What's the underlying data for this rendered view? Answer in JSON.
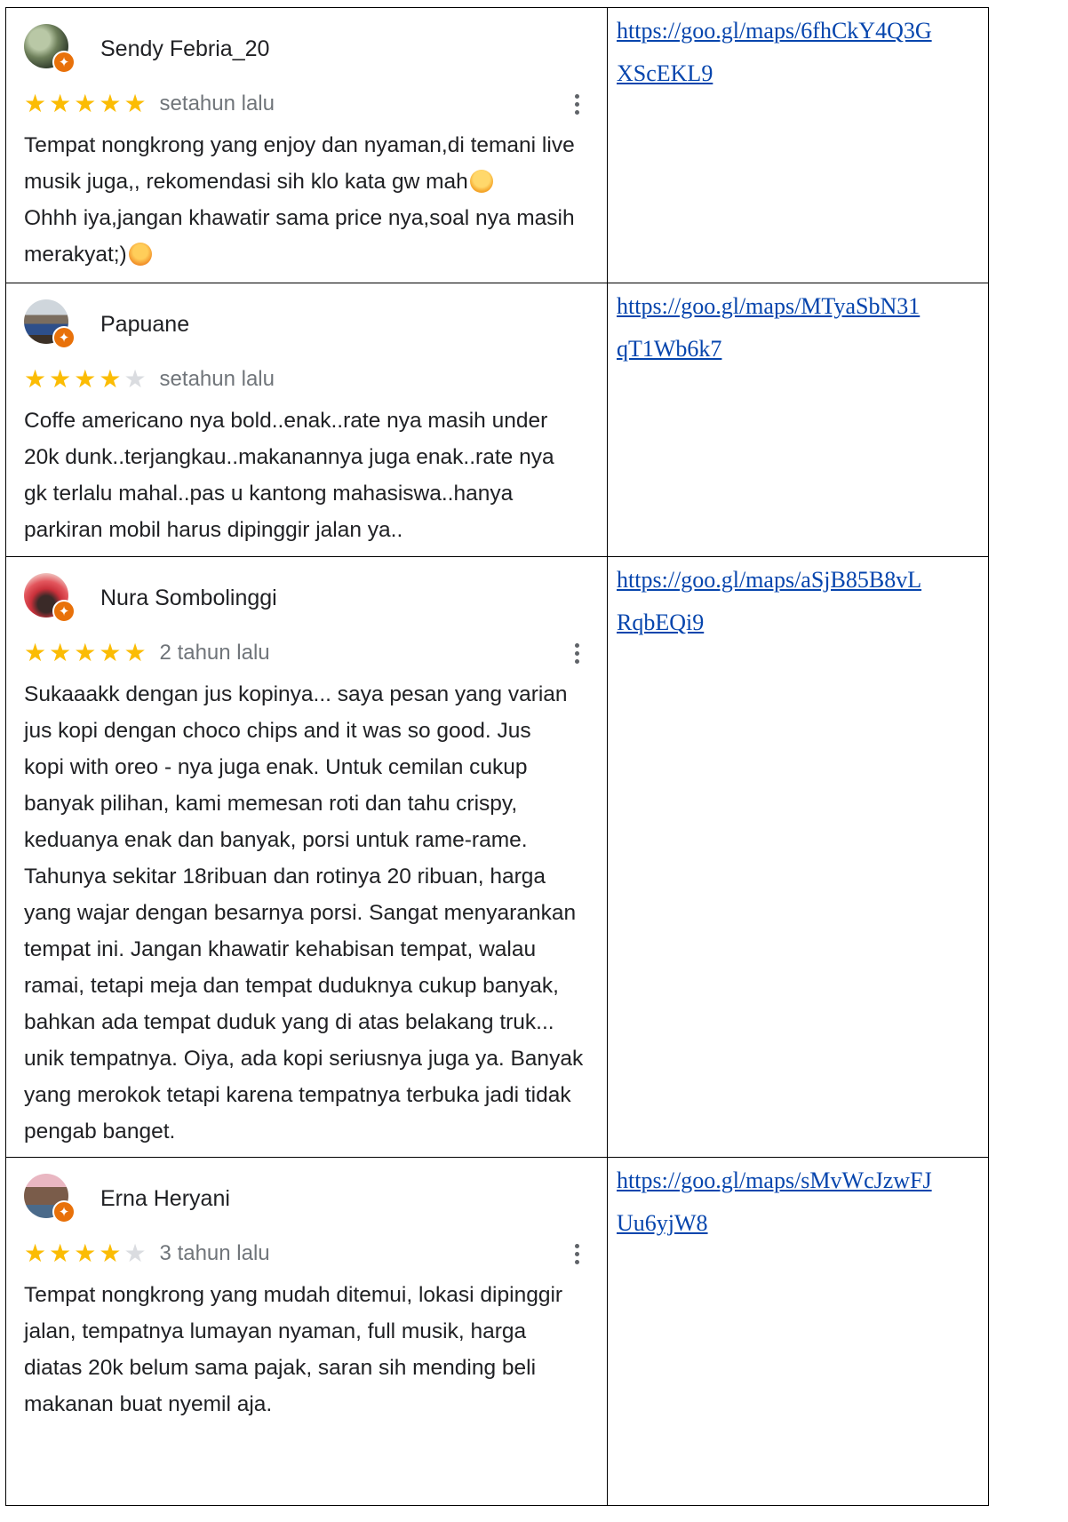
{
  "reviews": [
    {
      "name": "Sendy Febria_20",
      "rating": 5,
      "time": "setahun lalu",
      "text_line1": "Tempat nongkrong yang enjoy dan nyaman,di temani live",
      "text_line2": "musik juga,, rekomendasi sih klo kata gw mah",
      "text_line3": "Ohhh iya,jangan khawatir sama price nya,soal nya masih",
      "text_line4": "merakyat;)",
      "link_line1": "https://goo.gl/maps/6fhCkY4Q3G",
      "link_line2": "XScEKL9"
    },
    {
      "name": "Papuane",
      "rating": 4,
      "time": "setahun lalu",
      "text": "Coffe americano nya bold..enak..rate nya masih under\n20k dunk..terjangkau..makanannya juga enak..rate nya\ngk terlalu mahal..pas u kantong mahasiswa..hanya\nparkiran mobil harus dipinggir jalan ya..",
      "link_line1": "https://goo.gl/maps/MTyaSbN31",
      "link_line2": "qT1Wb6k7"
    },
    {
      "name": "Nura Sombolinggi",
      "rating": 5,
      "time": "2 tahun lalu",
      "text": "Sukaaakk dengan jus kopinya... saya pesan yang varian\njus kopi dengan choco chips and it was so good. Jus\nkopi with oreo - nya juga enak. Untuk cemilan cukup\nbanyak pilihan, kami memesan roti dan tahu crispy,\nkeduanya enak dan banyak, porsi untuk rame-rame.\nTahunya sekitar 18ribuan dan rotinya 20 ribuan, harga\nyang wajar dengan besarnya porsi. Sangat menyarankan\ntempat ini. Jangan khawatir kehabisan tempat, walau\nramai, tetapi meja dan tempat duduknya cukup banyak,\nbahkan ada tempat duduk yang di atas belakang truk...\nunik tempatnya. Oiya, ada kopi seriusnya juga ya. Banyak\nyang merokok tetapi karena tempatnya terbuka jadi tidak\npengab banget.",
      "link_line1": "https://goo.gl/maps/aSjB85B8vL",
      "link_line2": "RqbEQi9"
    },
    {
      "name": "Erna Heryani",
      "rating": 4,
      "time": "3 tahun lalu",
      "text": "Tempat nongkrong yang mudah ditemui, lokasi dipinggir\njalan, tempatnya lumayan nyaman, full musik, harga\ndiatas 20k belum sama pajak, saran sih mending beli\nmakanan buat nyemil aja.",
      "link_line1": "https://goo.gl/maps/sMvWcJzwFJ",
      "link_line2": "Uu6yjW8"
    }
  ],
  "colors": {
    "star_on": "#fbbc04",
    "star_off": "#dadce0",
    "badge": "#e8710a",
    "link": "#0645ad"
  },
  "icons": {
    "star": "star-icon",
    "badge": "local-guide-badge-icon",
    "more": "more-vert-icon"
  }
}
